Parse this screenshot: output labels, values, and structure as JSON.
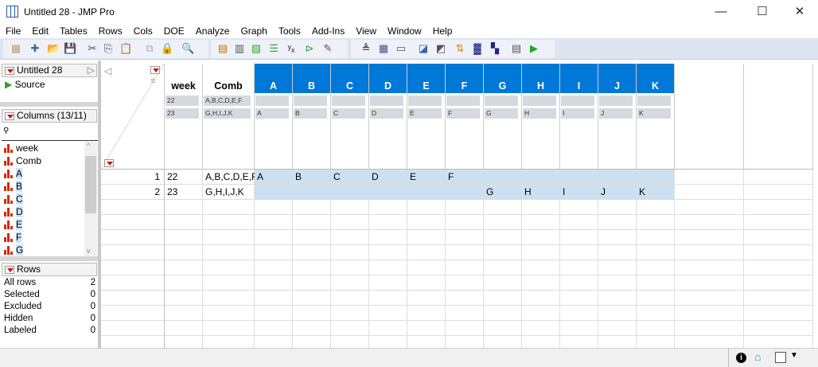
{
  "window": {
    "title": "Untitled 28 - JMP Pro",
    "minimize": "—",
    "maximize": "☐",
    "close": "✕"
  },
  "menu": [
    "File",
    "Edit",
    "Tables",
    "Rows",
    "Cols",
    "DOE",
    "Analyze",
    "Graph",
    "Tools",
    "Add-Ins",
    "View",
    "Window",
    "Help"
  ],
  "toolbar": {
    "icons": [
      "new-data-table-icon",
      "new-script-icon",
      "open-icon",
      "save-icon",
      "cut-icon",
      "copy-icon",
      "paste-icon",
      "link-icon",
      "lock-icon",
      "search-icon",
      "data-table-icon",
      "calculator-icon",
      "subset-icon",
      "distribution-icon",
      "fit-y-by-x-icon",
      "fit-model-icon",
      "edit-icon",
      "sort-icon",
      "table-icon",
      "formula-icon",
      "journal-icon",
      "report-icon",
      "stack-icon",
      "join-icon",
      "split-icon",
      "script-icon",
      "run-script-icon"
    ]
  },
  "left": {
    "table_panel": {
      "title": "Untitled 28",
      "items": [
        "Source"
      ]
    },
    "columns_panel": {
      "title": "Columns (13/11)",
      "search_placeholder": "",
      "columns": [
        "week",
        "Comb",
        "A",
        "B",
        "C",
        "D",
        "E",
        "F",
        "G"
      ],
      "selected_from": 2
    },
    "rows_panel": {
      "title": "Rows",
      "stats": [
        {
          "label": "All rows",
          "value": "2"
        },
        {
          "label": "Selected",
          "value": "0"
        },
        {
          "label": "Excluded",
          "value": "0"
        },
        {
          "label": "Hidden",
          "value": "0"
        },
        {
          "label": "Labeled",
          "value": "0"
        }
      ]
    }
  },
  "table": {
    "columns": [
      {
        "name": "week",
        "summary": [
          "22",
          "23"
        ],
        "selected": false
      },
      {
        "name": "Comb",
        "summary": [
          "A,B,C,D,E,F",
          "G,H,I,J,K"
        ],
        "selected": false
      },
      {
        "name": "A",
        "summary": [
          "",
          "A"
        ],
        "selected": true
      },
      {
        "name": "B",
        "summary": [
          "",
          "B"
        ],
        "selected": true
      },
      {
        "name": "C",
        "summary": [
          "",
          "C"
        ],
        "selected": true
      },
      {
        "name": "D",
        "summary": [
          "",
          "D"
        ],
        "selected": true
      },
      {
        "name": "E",
        "summary": [
          "",
          "E"
        ],
        "selected": true
      },
      {
        "name": "F",
        "summary": [
          "",
          "F"
        ],
        "selected": true
      },
      {
        "name": "G",
        "summary": [
          "",
          "G"
        ],
        "selected": true
      },
      {
        "name": "H",
        "summary": [
          "",
          "H"
        ],
        "selected": true
      },
      {
        "name": "I",
        "summary": [
          "",
          "I"
        ],
        "selected": true
      },
      {
        "name": "J",
        "summary": [
          "",
          "J"
        ],
        "selected": true
      },
      {
        "name": "K",
        "summary": [
          "",
          "K"
        ],
        "selected": true
      }
    ],
    "rows": [
      {
        "num": "1",
        "cells": [
          "22",
          "A,B,C,D,E,F",
          "A",
          "B",
          "C",
          "D",
          "E",
          "F",
          "",
          "",
          "",
          "",
          ""
        ]
      },
      {
        "num": "2",
        "cells": [
          "23",
          "G,H,I,J,K",
          "",
          "",
          "",
          "",
          "",
          "",
          "G",
          "H",
          "I",
          "J",
          "K"
        ]
      }
    ],
    "accent": "#0078d7",
    "selection_color": "#cde0f0"
  },
  "status": {
    "info_icon": "i"
  }
}
